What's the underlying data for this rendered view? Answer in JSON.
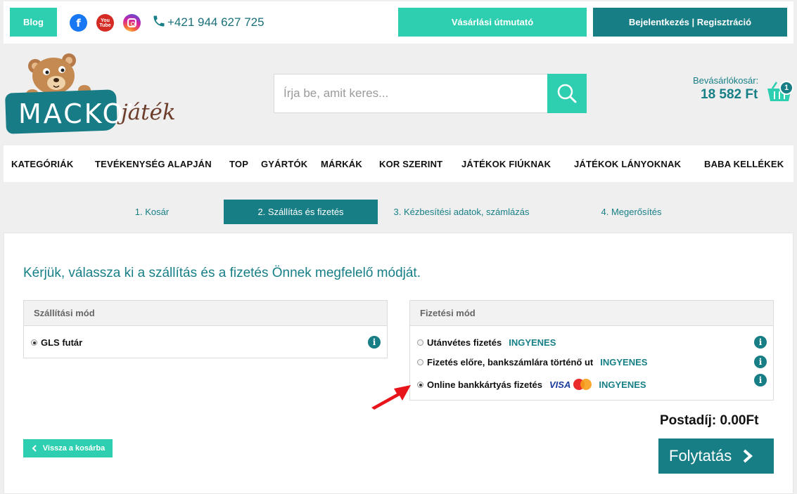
{
  "topbar": {
    "blog_label": "Blog",
    "phone": "+421 944 627 725",
    "guide_label": "Vásárlási útmutató",
    "login_label": "Bejelentkezés | Regisztráció"
  },
  "logo": {
    "text_main": "MACKO’",
    "text_sub": "játék"
  },
  "search": {
    "placeholder": "Írja be, amit keres..."
  },
  "cart": {
    "label": "Bevásárlókosár:",
    "total": "18 582 Ft",
    "count": "1"
  },
  "nav": {
    "items": [
      "KATEGÓRIÁK",
      "TEVÉKENYSÉG ALAPJÁN",
      "TOP",
      "GYÁRTÓK",
      "MÁRKÁK",
      "KOR SZERINT",
      "JÁTÉKOK FIÚKNAK",
      "JÁTÉKOK LÁNYOKNAK",
      "BABA KELLÉKEK"
    ]
  },
  "steps": [
    {
      "label": "1. Kosár",
      "active": false
    },
    {
      "label": "2. Szállítás és fizetés",
      "active": true
    },
    {
      "label": "3. Kézbesítési adatok, számlázás",
      "active": false
    },
    {
      "label": "4. Megerősítés",
      "active": false
    }
  ],
  "main": {
    "heading": "Kérjük, válassza ki a szállítás és a fizetés Önnek megfelelő módját.",
    "shipping": {
      "title": "Szállítási mód",
      "options": [
        {
          "label": "GLS futár",
          "selected": true
        }
      ]
    },
    "payment": {
      "title": "Fizetési mód",
      "options": [
        {
          "label": "Utánvétes fizetés",
          "price": "INGYENES",
          "selected": false
        },
        {
          "label": "Fizetés előre, bankszámlára történő ut",
          "price": "INGYENES",
          "selected": false
        },
        {
          "label": "Online bankkártyás fizetés",
          "card_brand": "VISA",
          "price": "INGYENES",
          "selected": true
        }
      ]
    },
    "postage": "Postadíj: 0.00Ft",
    "back_label": "Vissza a kosárba",
    "continue_label": "Folytatás"
  },
  "colors": {
    "accent": "#2ecfb1",
    "primary": "#177e86",
    "arrow": "#e8141b"
  },
  "icons": [
    "facebook-icon",
    "youtube-icon",
    "instagram-icon",
    "phone-icon",
    "search-icon",
    "cart-icon",
    "info-icon",
    "chevron-left-icon",
    "chevron-right-icon",
    "red-arrow-icon"
  ]
}
